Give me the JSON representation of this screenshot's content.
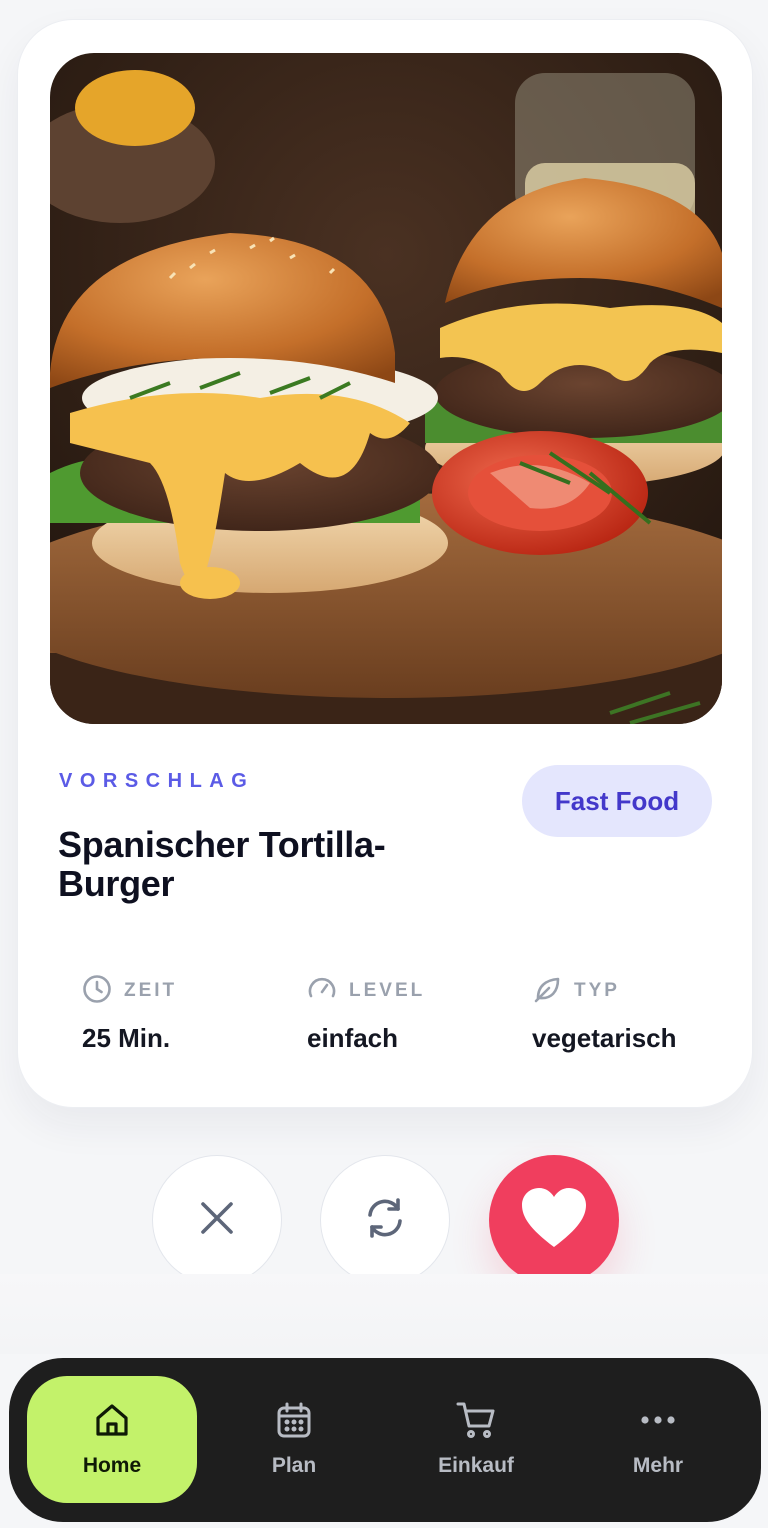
{
  "recipe": {
    "eyebrow": "VORSCHLAG",
    "title": "Spanischer Tortilla-Burger",
    "tag": "Fast Food",
    "image_icon": "burger-photo"
  },
  "meta": [
    {
      "icon": "clock-icon",
      "label": "ZEIT",
      "value": "25 Min."
    },
    {
      "icon": "gauge-icon",
      "label": "LEVEL",
      "value": "einfach"
    },
    {
      "icon": "leaf-icon",
      "label": "TYP",
      "value": "vegetarisch"
    }
  ],
  "actions": [
    {
      "name": "dismiss",
      "icon": "close-icon"
    },
    {
      "name": "refresh",
      "icon": "refresh-icon"
    },
    {
      "name": "like",
      "icon": "heart-icon"
    }
  ],
  "nav": [
    {
      "label": "Home",
      "icon": "home-icon",
      "active": true
    },
    {
      "label": "Plan",
      "icon": "calendar-icon",
      "active": false
    },
    {
      "label": "Einkauf",
      "icon": "cart-icon",
      "active": false
    },
    {
      "label": "Mehr",
      "icon": "more-icon",
      "active": false
    }
  ],
  "colors": {
    "accent": "#5b5be6",
    "tag_bg": "#e4e6fd",
    "like": "#f03e5e",
    "nav_bg": "#1e1e1e",
    "nav_active": "#c3f26a"
  }
}
